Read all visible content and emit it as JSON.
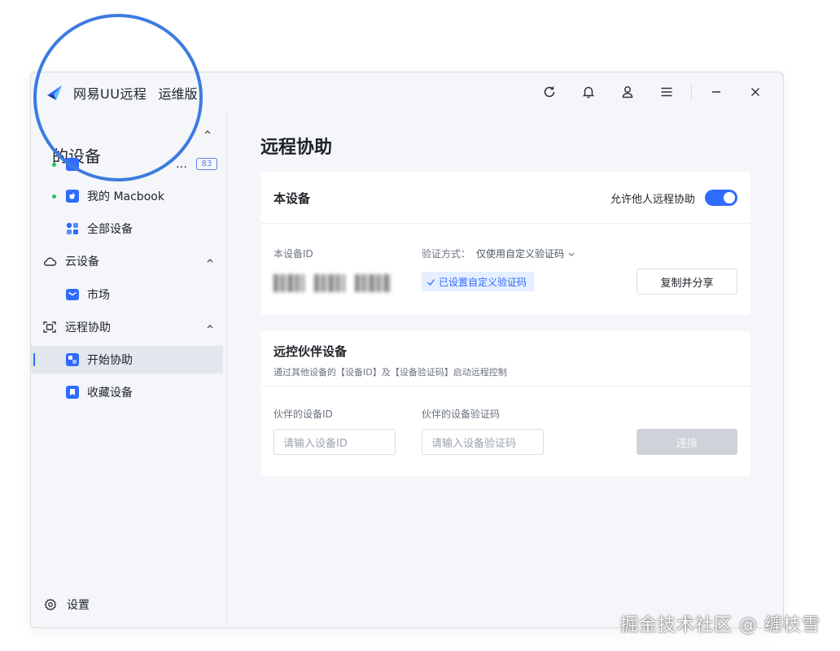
{
  "app": {
    "name": "网易UU远程",
    "edition": "运维版"
  },
  "sidebar": {
    "my_devices_heading": "的设备",
    "items": [
      {
        "label": "…",
        "badge": "83"
      },
      {
        "label": "我的 Macbook"
      },
      {
        "label": "全部设备"
      }
    ],
    "cloud_group": "云设备",
    "cloud_items": [
      {
        "label": "市场"
      }
    ],
    "remote_group": "远程协助",
    "remote_items": [
      {
        "label": "开始协助"
      },
      {
        "label": "收藏设备"
      }
    ],
    "settings_label": "设置"
  },
  "main": {
    "page_title": "远程协助",
    "this_device": {
      "title": "本设备",
      "allow_label": "允许他人远程协助",
      "device_id_label": "本设备ID",
      "verify_label": "验证方式：",
      "verify_value": "仅使用自定义验证码",
      "verified_tag": "已设置自定义验证码",
      "copy_button": "复制并分享"
    },
    "partner": {
      "title": "远控伙伴设备",
      "subtitle": "通过其他设备的【设备ID】及【设备验证码】启动远程控制",
      "id_label": "伙伴的设备ID",
      "code_label": "伙伴的设备验证码",
      "id_placeholder": "请输入设备ID",
      "code_placeholder": "请输入设备验证码",
      "connect_button": "连接"
    }
  },
  "watermark": "掘金技术社区 @ 缠枝雪",
  "colors": {
    "accent": "#2f6bff",
    "online": "#22c55e",
    "annotation": "#3d7be0"
  }
}
